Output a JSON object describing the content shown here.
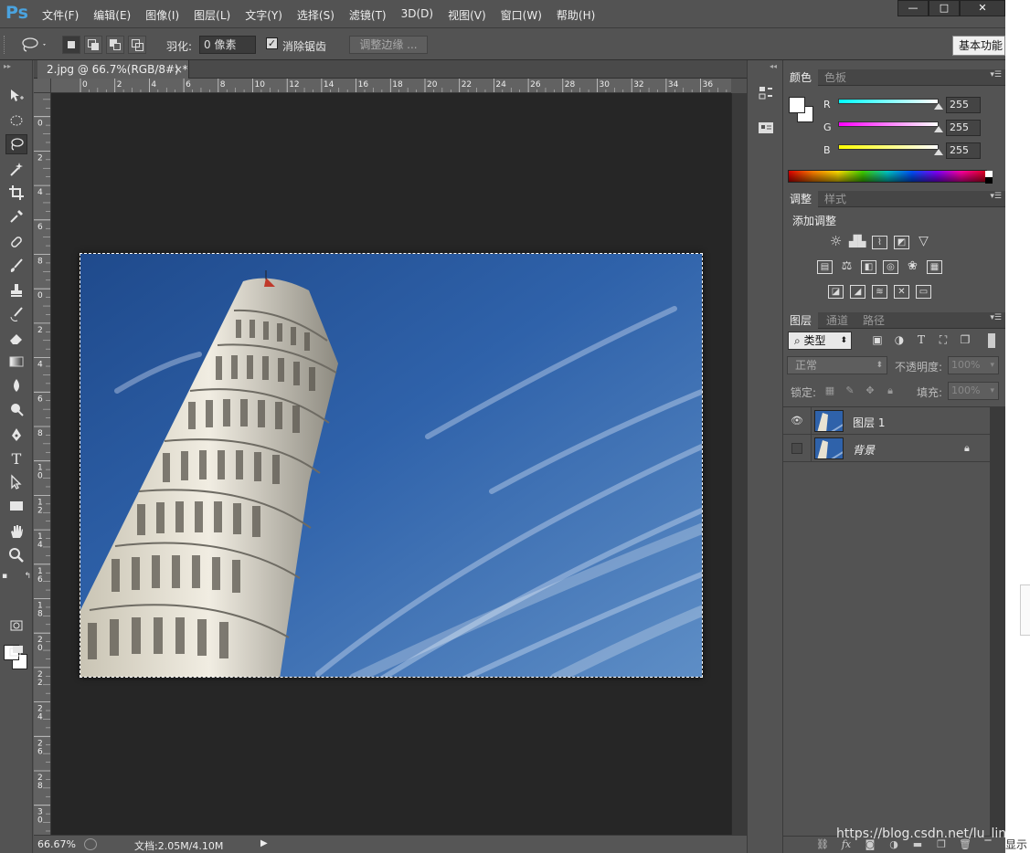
{
  "app": {
    "logo": "Ps",
    "menu": [
      "文件(F)",
      "编辑(E)",
      "图像(I)",
      "图层(L)",
      "文字(Y)",
      "选择(S)",
      "滤镜(T)",
      "3D(D)",
      "视图(V)",
      "窗口(W)",
      "帮助(H)"
    ],
    "window_buttons": {
      "minimize": "—",
      "maximize": "□",
      "close": "✕"
    }
  },
  "options": {
    "feather_label": "羽化:",
    "feather_value": "0 像素",
    "antialias_label": "消除锯齿",
    "antialias_checked": true,
    "refine_edge": "调整边缘 ...",
    "workspace": "基本功能"
  },
  "document": {
    "tab_title": "2.jpg @ 66.7%(RGB/8#) *",
    "tab_close": "×",
    "ruler_x": [
      "0",
      "2",
      "4",
      "6",
      "8",
      "10",
      "12",
      "14",
      "16",
      "18",
      "20",
      "22",
      "24",
      "26",
      "28",
      "30",
      "32",
      "34",
      "36"
    ],
    "ruler_y": [
      "2",
      "0",
      "2",
      "4",
      "6",
      "8",
      "0",
      "2",
      "4",
      "6",
      "8",
      "10",
      "12",
      "14",
      "16",
      "18",
      "20",
      "22",
      "24",
      "26",
      "28",
      "30",
      "32"
    ],
    "zoom": "66.67%",
    "doc_size": "文档:2.05M/4.10M"
  },
  "color_panel": {
    "tabs": [
      "颜色",
      "色板"
    ],
    "channels": [
      {
        "label": "R",
        "value": "255",
        "gradient": "#00ffff"
      },
      {
        "label": "G",
        "value": "255",
        "gradient": "#ff00ff"
      },
      {
        "label": "B",
        "value": "255",
        "gradient": "#ffff00"
      }
    ]
  },
  "adjust_panel": {
    "tabs": [
      "调整",
      "样式"
    ],
    "title": "添加调整"
  },
  "layers_panel": {
    "tabs": [
      "图层",
      "通道",
      "路径"
    ],
    "kind_filter": "类型",
    "blend_mode": "正常",
    "opacity_label": "不透明度:",
    "opacity_value": "100%",
    "lock_label": "锁定:",
    "fill_label": "填充:",
    "fill_value": "100%",
    "layers": [
      {
        "name": "图层 1",
        "visible": true,
        "locked": false
      },
      {
        "name": "背景",
        "visible": false,
        "locked": true
      }
    ]
  },
  "watermark": "https://blog.csdn.net/lu_linux",
  "edge_fragment": "显示"
}
